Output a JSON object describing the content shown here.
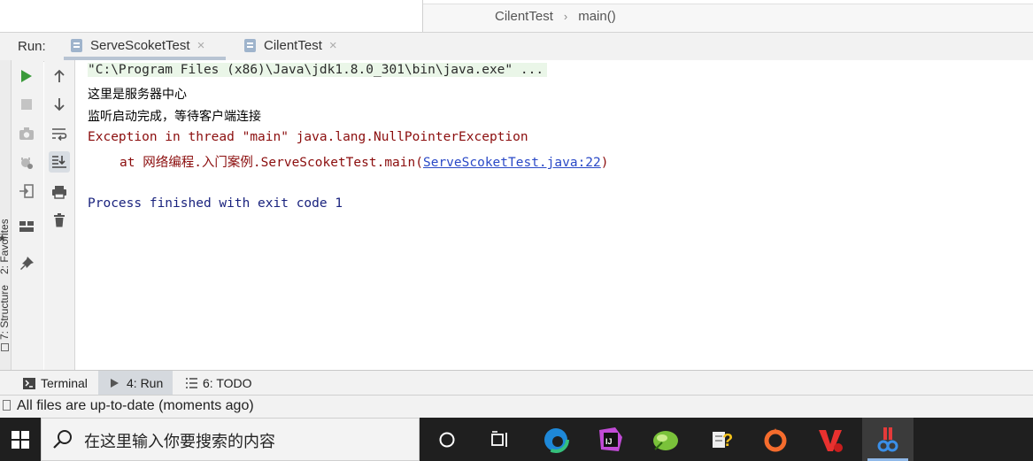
{
  "editor": {
    "breadcrumb": [
      "CilentTest",
      "main()"
    ]
  },
  "run_panel": {
    "label": "Run:",
    "tabs": [
      {
        "label": "ServeScoketTest",
        "active": true
      },
      {
        "label": "CilentTest",
        "active": false
      }
    ]
  },
  "side_stripe": {
    "favorites": "2: Favorites",
    "structure": "7: Structure"
  },
  "console": {
    "lines": [
      "\"C:\\Program Files (x86)\\Java\\jdk1.8.0_301\\bin\\java.exe\" ...",
      "这里是服务器中心",
      "监听启动完成，等待客户端连接",
      "Exception in thread \"main\" java.lang.NullPointerException",
      "at 网络编程.入门案例.ServeScoketTest.main(",
      "ServeScoketTest.java:22",
      ")",
      "Process finished with exit code 1"
    ]
  },
  "tool_tabs": [
    {
      "label": "Terminal"
    },
    {
      "label": "4: Run"
    },
    {
      "label": "6: TODO"
    }
  ],
  "status": {
    "text": "All files are up-to-date (moments ago)"
  },
  "taskbar": {
    "search_placeholder": "在这里输入你要搜索的内容"
  },
  "colors": {
    "run_green": "#3a9a3a",
    "error_text": "#8b0d0d",
    "link": "#2a49c7",
    "taskbar": "#1f1f1f"
  }
}
